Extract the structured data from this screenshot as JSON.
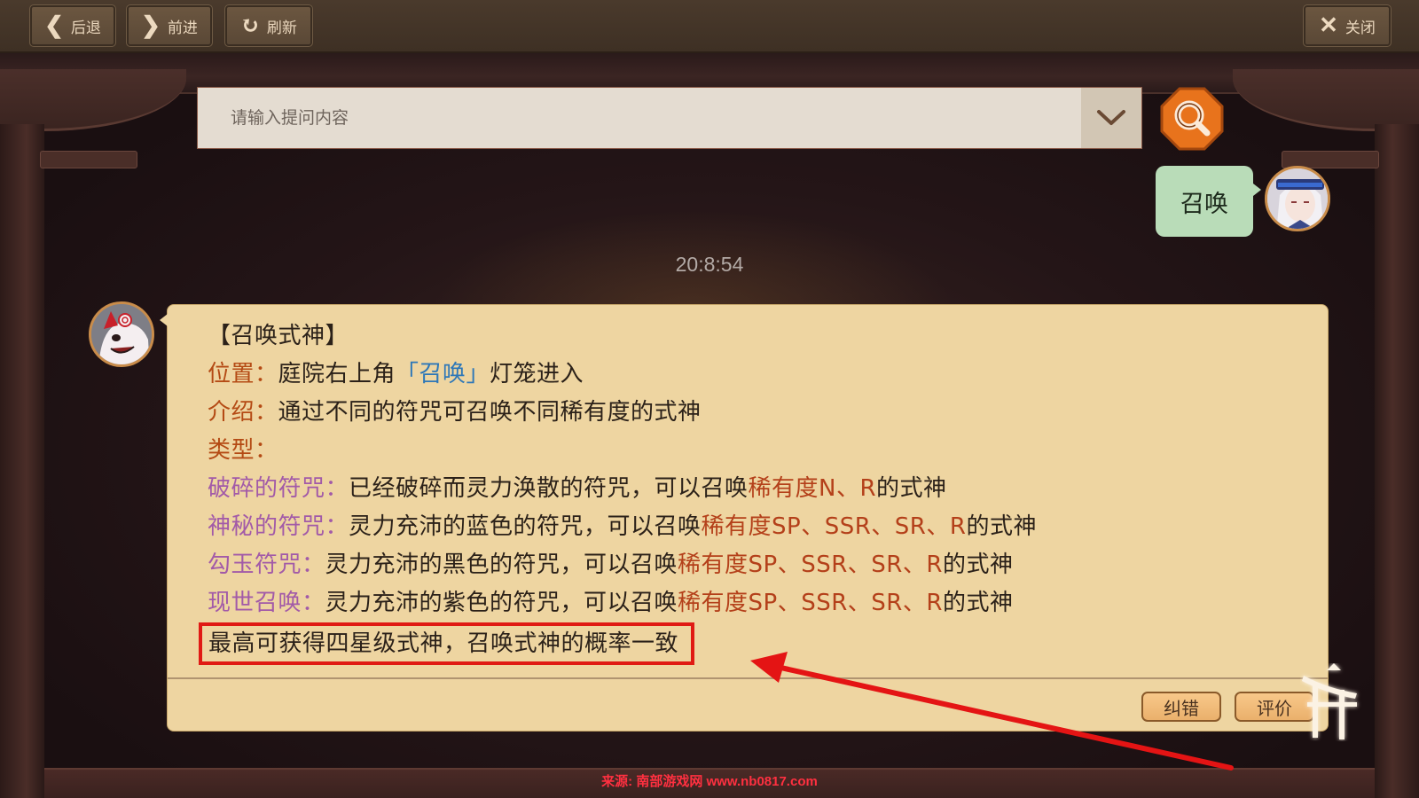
{
  "toolbar": {
    "back_label": "后退",
    "forward_label": "前进",
    "refresh_label": "刷新",
    "close_label": "关闭",
    "back_icon": "chevron-left-icon",
    "forward_icon": "chevron-right-icon",
    "refresh_icon": "refresh-icon",
    "close_icon": "close-icon"
  },
  "search": {
    "placeholder": "请输入提问内容",
    "value": "",
    "dropdown_icon": "chevron-down-icon",
    "button_icon": "search-icon",
    "button_color": "#e8731c"
  },
  "chat": {
    "user_message": "召唤",
    "timestamp": "20:8:54",
    "answer": {
      "title": "【召唤式神】",
      "location_label": "位置：",
      "location_prefix": "庭院右上角",
      "location_link": "「召唤」",
      "location_suffix": "灯笼进入",
      "intro_label": "介绍：",
      "intro_text": "通过不同的符咒可召唤不同稀有度的式神",
      "type_label": "类型：",
      "types": [
        {
          "name": "破碎的符咒：",
          "desc": "已经破碎而灵力涣散的符咒，可以召唤",
          "rarity": "稀有度N、R",
          "suffix": "的式神"
        },
        {
          "name": "神秘的符咒：",
          "desc": "灵力充沛的蓝色的符咒，可以召唤",
          "rarity": "稀有度SP、SSR、SR、R",
          "suffix": "的式神"
        },
        {
          "name": "勾玉符咒：",
          "desc": "灵力充沛的黑色的符咒，可以召唤",
          "rarity": "稀有度SP、SSR、SR、R",
          "suffix": "的式神"
        },
        {
          "name": "现世召唤：",
          "desc": "灵力充沛的紫色的符咒，可以召唤",
          "rarity": "稀有度SP、SSR、SR、R",
          "suffix": "的式神"
        }
      ],
      "note": "最高可获得四星级式神，召唤式神的概率一致"
    },
    "actions": {
      "correct_label": "纠错",
      "rate_label": "评价"
    }
  },
  "colors": {
    "card_bg": "#eed5a1",
    "label_orange": "#b44a14",
    "label_purple": "#a25aa8",
    "link_blue": "#2d77b8",
    "rarity_red": "#b4401a",
    "annotation_red": "#e01a14",
    "user_bubble": "#b9dcb8"
  },
  "watermark": "来源: 南部游戏网 www.nb0817.com"
}
